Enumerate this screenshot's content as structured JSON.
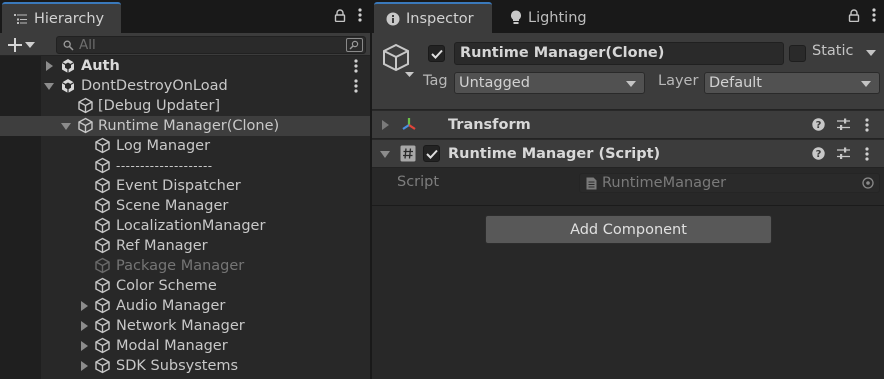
{
  "hierarchy": {
    "tab_label": "Hierarchy",
    "search_placeholder": "All",
    "rows": [
      {
        "label": "Auth",
        "bold": true
      },
      {
        "label": "DontDestroyOnLoad"
      },
      {
        "label": "[Debug Updater]"
      },
      {
        "label": "Runtime Manager(Clone)"
      },
      {
        "label": "Log Manager"
      },
      {
        "label": "--------------------"
      },
      {
        "label": "Event Dispatcher"
      },
      {
        "label": "Scene Manager"
      },
      {
        "label": "LocalizationManager"
      },
      {
        "label": "Ref Manager"
      },
      {
        "label": "Package Manager",
        "dim": true
      },
      {
        "label": "Color Scheme"
      },
      {
        "label": "Audio Manager"
      },
      {
        "label": "Network Manager"
      },
      {
        "label": "Modal Manager"
      },
      {
        "label": "SDK Subsystems"
      }
    ]
  },
  "inspector": {
    "tab_label": "Inspector",
    "lighting_tab_label": "Lighting",
    "object_name": "Runtime Manager(Clone)",
    "static_label": "Static",
    "tag_label": "Tag",
    "tag_value": "Untagged",
    "layer_label": "Layer",
    "layer_value": "Default",
    "components": [
      {
        "title": "Transform"
      },
      {
        "title": "Runtime Manager (Script)"
      }
    ],
    "script_label": "Script",
    "script_value": "RuntimeManager",
    "add_component_label": "Add Component"
  },
  "colors": {
    "accent": "#3a79bb",
    "panel": "#282828",
    "header": "#3c3c3c",
    "background": "#191919"
  }
}
